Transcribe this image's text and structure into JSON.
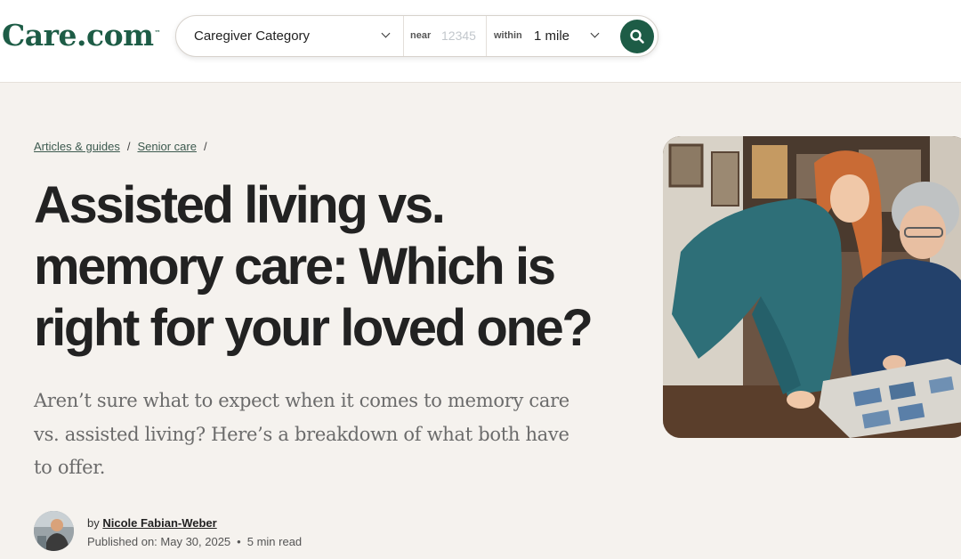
{
  "header": {
    "logo": "Care.com",
    "logo_tm": "™"
  },
  "search": {
    "category": "Caregiver Category",
    "near_label": "near",
    "near_placeholder": "12345",
    "within_label": "within",
    "within_value": "1 mile",
    "submit_icon": "search-icon"
  },
  "breadcrumb": {
    "items": [
      "Articles & guides",
      "Senior care"
    ],
    "separator": "/"
  },
  "article": {
    "title": "Assisted living vs. memory care: Which is right for your loved one?",
    "subtitle": "Aren’t sure what to expect when it comes to memory care vs. assisted living? Here’s a breakdown of what both have to offer.",
    "by_prefix": "by",
    "author": "Nicole Fabian-Weber",
    "published": "Published on: May 30, 2025",
    "read_time": "5 min read"
  },
  "colors": {
    "brand_green": "#1d5c46",
    "page_bg": "#f5f2ee"
  }
}
